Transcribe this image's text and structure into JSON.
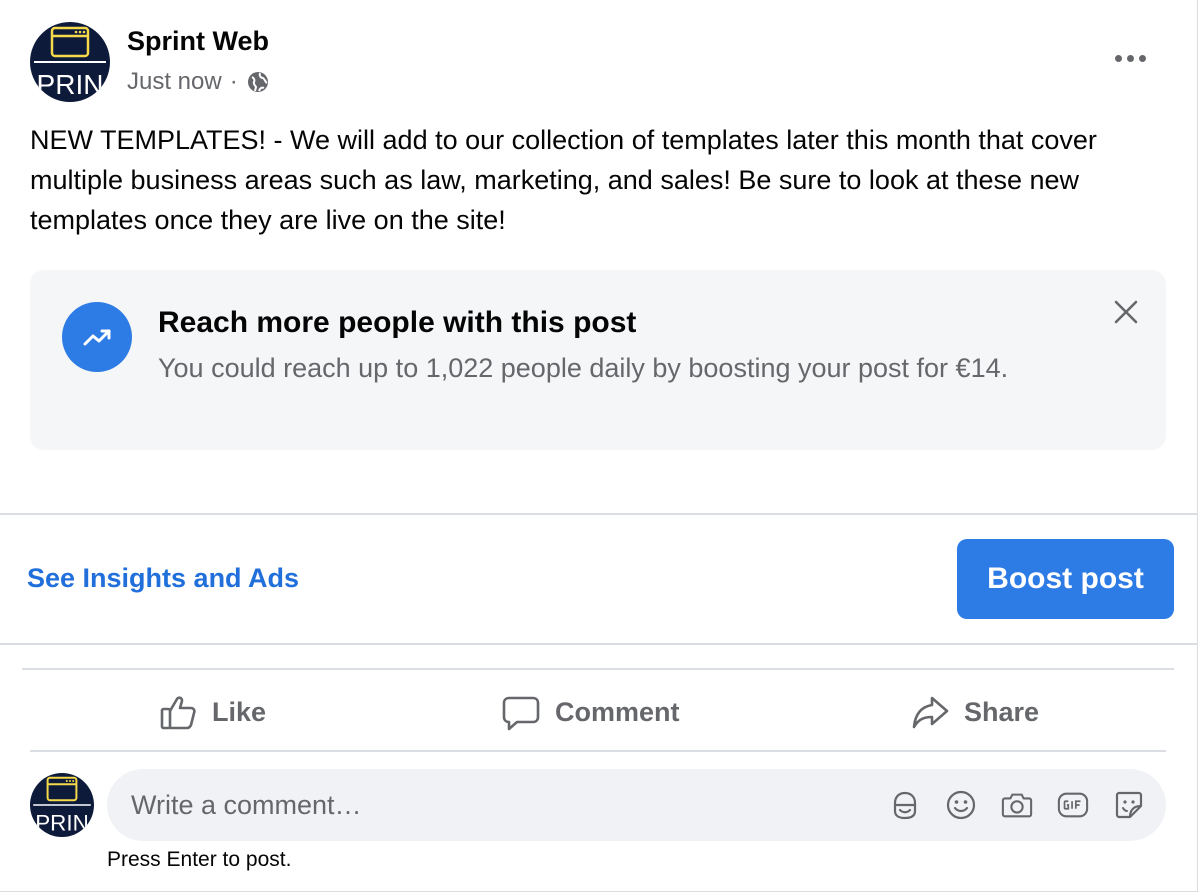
{
  "post": {
    "page_name": "Sprint Web",
    "timestamp": "Just now",
    "separator": "·",
    "privacy_icon": "globe-icon",
    "avatar_text": "PRIN",
    "text": "NEW TEMPLATES! - We will add to our collection of templates later this month that cover multiple business areas such as law, marketing, and sales! Be sure to look at these new templates once they are live on the site!"
  },
  "boost_prompt": {
    "title": "Reach more people with this post",
    "description": "You could reach up to 1,022 people daily by boosting your post for €14.",
    "icon": "trending-up-icon"
  },
  "footer": {
    "insights_label": "See Insights and Ads",
    "boost_label": "Boost post"
  },
  "actions": {
    "like": "Like",
    "comment": "Comment",
    "share": "Share"
  },
  "comment": {
    "placeholder": "Write a comment…",
    "hint": "Press Enter to post.",
    "avatar_text": "PRIN",
    "icons": [
      "avatar-sticker-icon",
      "emoji-icon",
      "camera-icon",
      "gif-icon",
      "sticker-icon"
    ]
  },
  "colors": {
    "accent": "#2d7be5",
    "link": "#216fdb",
    "secondary_text": "#65676b",
    "box_bg": "#f5f6f7",
    "avatar_bg": "#0d1a3a",
    "avatar_accent": "#f5d94a"
  }
}
